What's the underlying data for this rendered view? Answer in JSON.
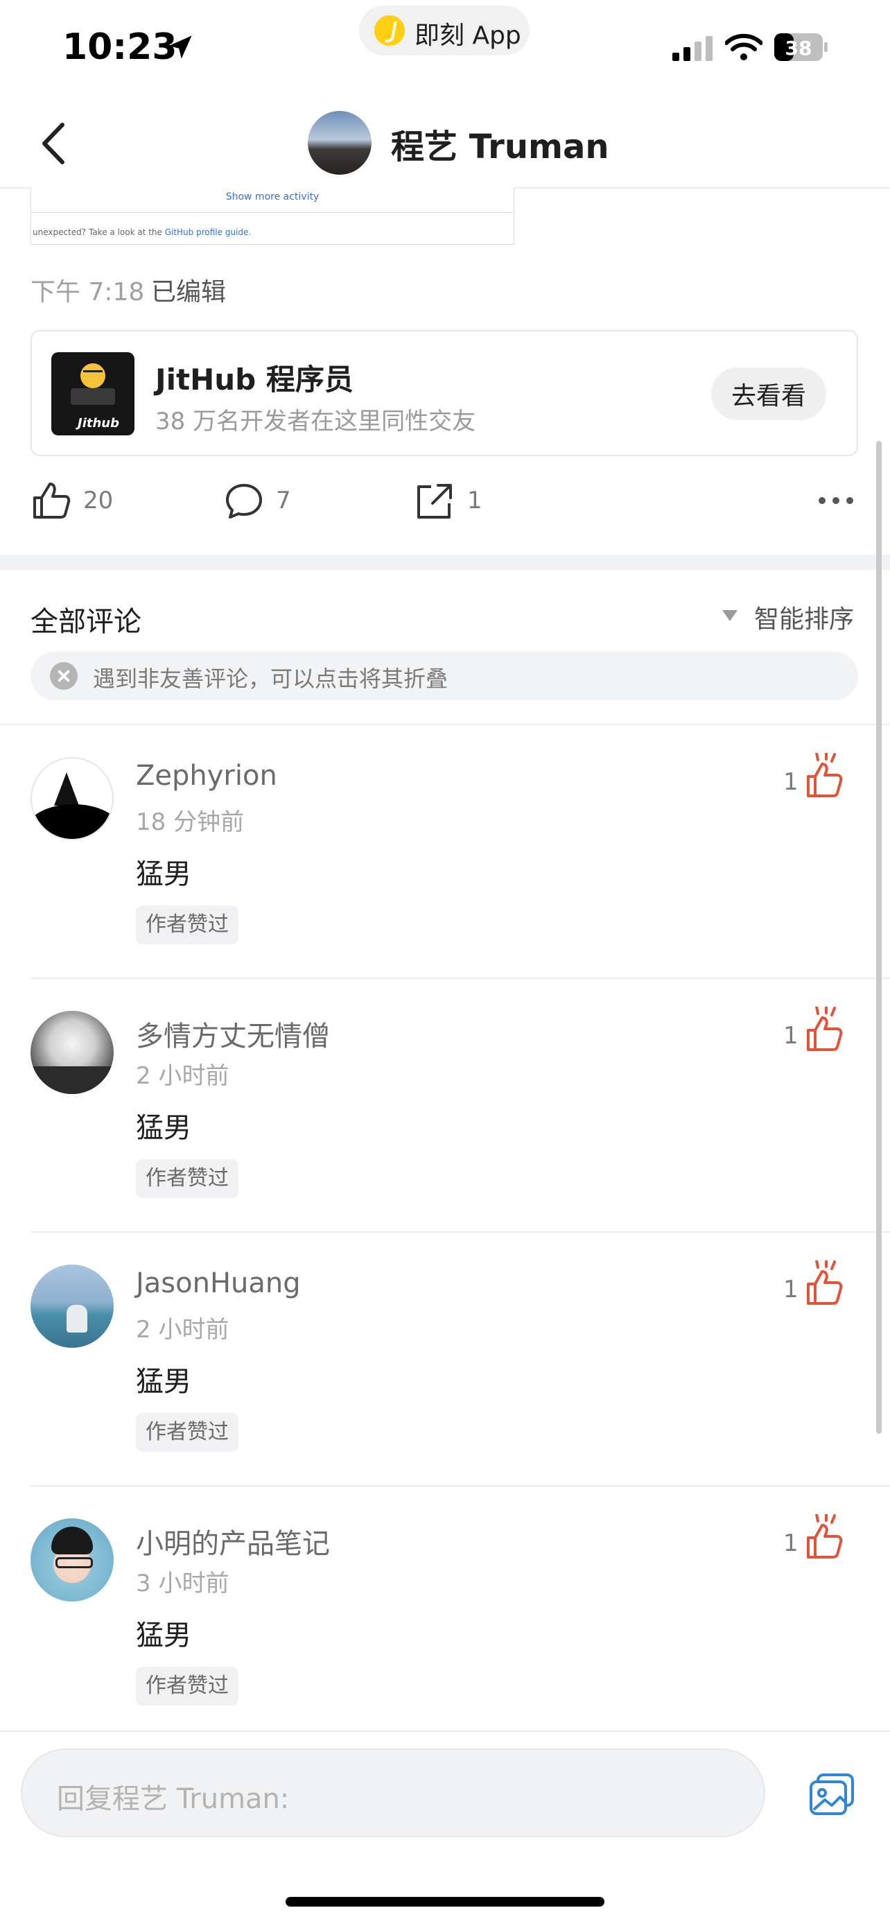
{
  "status_bar": {
    "time": "10:23",
    "app_pill": "即刻 App",
    "battery": "38"
  },
  "nav": {
    "title": "程艺 Truman"
  },
  "post": {
    "screenshot": {
      "show_more": "Show more activity",
      "footer_prefix": "unexpected? Take a look at the ",
      "footer_link": "GitHub profile guide",
      "footer_suffix": "."
    },
    "time": "下午 7:18",
    "edited": "已编辑",
    "link_card": {
      "title": "JitHub 程序员",
      "subtitle": "38 万名开发者在这里同性交友",
      "button": "去看看",
      "thumb_logo": "Jithub"
    },
    "likes": "20",
    "comments": "7",
    "shares": "1"
  },
  "comments_header": {
    "title": "全部评论",
    "sort": "智能排序",
    "tip": "遇到非友善评论，可以点击将其折叠"
  },
  "comments": [
    {
      "name": "Zephyrion",
      "time": "18 分钟前",
      "text": "猛男",
      "tag": "作者赞过",
      "likes": "1"
    },
    {
      "name": "多情方丈无情僧",
      "time": "2 小时前",
      "text": "猛男",
      "tag": "作者赞过",
      "likes": "1"
    },
    {
      "name": "JasonHuang",
      "time": "2 小时前",
      "text": "猛男",
      "tag": "作者赞过",
      "likes": "1"
    },
    {
      "name": "小明的产品笔记",
      "time": "3 小时前",
      "text": "猛男",
      "tag": "作者赞过",
      "likes": "1"
    }
  ],
  "reply": {
    "placeholder": "回复程艺 Truman:"
  },
  "colors": {
    "accent": "#e0553a",
    "link": "#3b6fd0",
    "icon_blue": "#2f86d8"
  }
}
